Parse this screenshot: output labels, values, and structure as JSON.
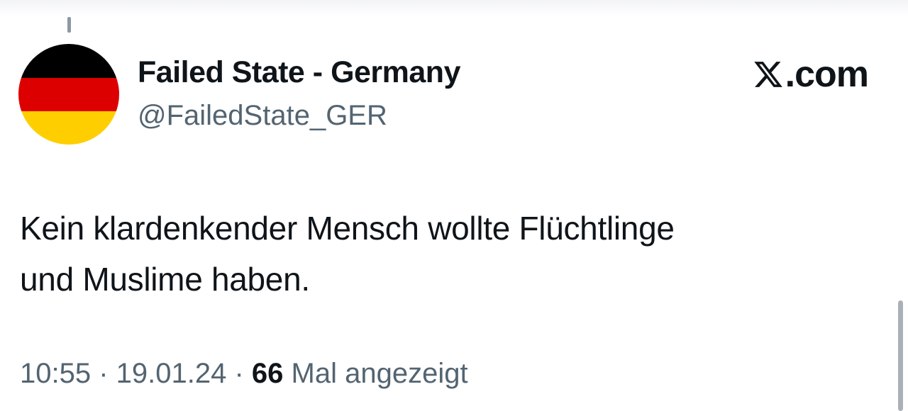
{
  "brand": {
    "logo_glyph": "𝕏",
    "logo_suffix": ".com",
    "icon": "x-logo-icon"
  },
  "author": {
    "display_name": "Failed State - Germany",
    "handle": "@FailedState_GER",
    "avatar_icon": "german-flag-avatar",
    "avatar_colors": [
      "#000000",
      "#dd0000",
      "#ffce00"
    ]
  },
  "tweet": {
    "text_line_1": "Kein klardenkender Mensch wollte Flüchtlinge",
    "text_line_2": "und Muslime haben.",
    "time": "10:55",
    "separator_1": " · ",
    "date": "19.01.24",
    "separator_2": " · ",
    "views_count": "66",
    "views_label": " Mal angezeigt"
  },
  "colors": {
    "text_primary": "#0f1419",
    "text_secondary": "#536471"
  }
}
